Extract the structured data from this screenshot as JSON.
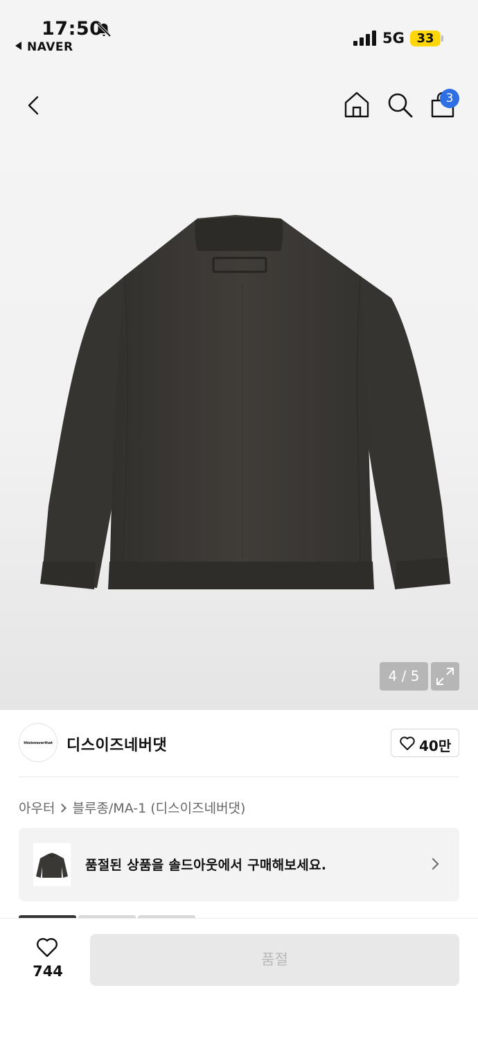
{
  "status_bar": {
    "time": "17:50",
    "back_app": "NAVER",
    "network": "5G",
    "battery": "33",
    "icons": [
      "bell-slash-icon",
      "signal-icon"
    ]
  },
  "header": {
    "icons": [
      "back-icon",
      "home-icon",
      "search-icon",
      "bag-icon"
    ],
    "cart_count": "3"
  },
  "gallery": {
    "counter": "4 / 5",
    "expand_icon": "expand-icon"
  },
  "brand": {
    "logo_text": "thisisneverthat",
    "name": "디스이즈네버댓",
    "like_count": "40만"
  },
  "breadcrumb": {
    "category": "아우터",
    "subcategory": "블루종/MA-1 (디스이즈네버댓)"
  },
  "soldout_banner": {
    "text": "품절된 상품을 솔드아웃에서 구매해보세요."
  },
  "bottom_bar": {
    "wish_count": "744",
    "buy_label": "품절"
  },
  "colors": {
    "accent_badge": "#2f6fe4",
    "battery": "#ffd60a",
    "jacket": "#3a3835"
  }
}
